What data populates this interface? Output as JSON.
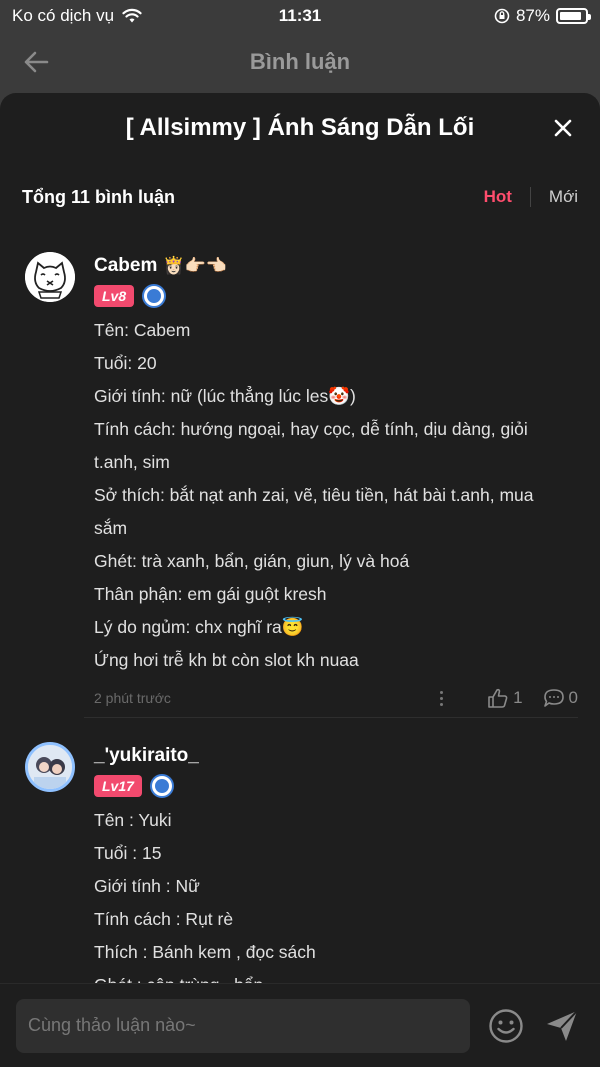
{
  "status_bar": {
    "carrier": "Ko có dịch vụ",
    "time": "11:31",
    "battery": "87%",
    "battery_level": 0.87
  },
  "nav": {
    "title": "Bình luận"
  },
  "sheet": {
    "title": "[ Allsimmy ] Ánh Sáng Dẫn Lối"
  },
  "filter": {
    "count": "Tổng 11 bình luận",
    "sort_hot": "Hot",
    "sort_new": "Mới"
  },
  "comments": [
    {
      "username": "Cabem",
      "name_emoji": "👸🏻👉🏻👈🏻",
      "level": "Lv8",
      "lines": [
        "Tên: Cabem",
        "Tuổi: 20",
        "Giới tính: nữ (lúc thẳng lúc les🤡)",
        "Tính cách: hướng ngoại, hay cọc, dễ tính, dịu dàng, giỏi",
        "t.anh, sim",
        "Sở thích: bắt nạt anh zai, vẽ, tiêu tiền, hát bài t.anh, mua",
        "sắm",
        "Ghét: trà xanh, bẩn, gián, giun, lý và hoá",
        "Thân phận: em gái guột kresh",
        "Lý do ngủm: chx nghĩ ra😇",
        "Ứng hơi trễ kh bt còn slot kh nuaa"
      ],
      "time": "2 phút trước",
      "likes": "1",
      "replies": "0"
    },
    {
      "username": "_'yukiraito_",
      "level": "Lv17",
      "lines": [
        "Tên : Yuki",
        "Tuổi : 15",
        "Giới tính : Nữ",
        "Tính cách : Rụt rè",
        "Thích : Bánh kem , đọc sách",
        "Ghét : côn trùng , bẩn"
      ]
    }
  ],
  "input": {
    "placeholder": "Cùng thảo luận nào~"
  },
  "colors": {
    "accent": "#ff4d6d",
    "level_badge": "#f24a6e",
    "verify": "#3a7bd5",
    "sheet_bg": "#1e1e1e"
  }
}
